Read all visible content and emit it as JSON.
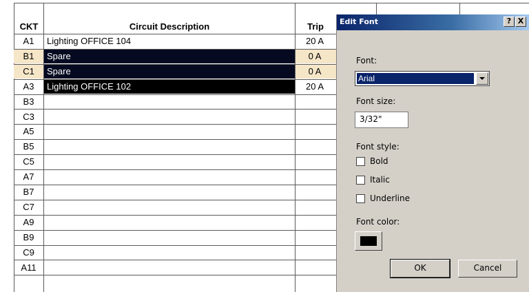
{
  "schedule": {
    "headers": {
      "ckt": "CKT",
      "description": "Circuit Description",
      "trip": "Trip"
    },
    "rows": [
      {
        "ckt": "A1",
        "description": "Lighting OFFICE 104",
        "trip": "20 A",
        "state": "normal"
      },
      {
        "ckt": "B1",
        "description": "Spare",
        "trip": "0 A",
        "state": "selected-light"
      },
      {
        "ckt": "C1",
        "description": "Spare",
        "trip": "0 A",
        "state": "selected-light"
      },
      {
        "ckt": "A3",
        "description": "Lighting OFFICE 102",
        "trip": "20 A",
        "state": "selected-dark"
      },
      {
        "ckt": "B3",
        "description": "",
        "trip": "",
        "state": "normal"
      },
      {
        "ckt": "C3",
        "description": "",
        "trip": "",
        "state": "normal"
      },
      {
        "ckt": "A5",
        "description": "",
        "trip": "",
        "state": "normal"
      },
      {
        "ckt": "B5",
        "description": "",
        "trip": "",
        "state": "normal"
      },
      {
        "ckt": "C5",
        "description": "",
        "trip": "",
        "state": "normal"
      },
      {
        "ckt": "A7",
        "description": "",
        "trip": "",
        "state": "normal"
      },
      {
        "ckt": "B7",
        "description": "",
        "trip": "",
        "state": "normal"
      },
      {
        "ckt": "C7",
        "description": "",
        "trip": "",
        "state": "normal"
      },
      {
        "ckt": "A9",
        "description": "",
        "trip": "",
        "state": "normal"
      },
      {
        "ckt": "B9",
        "description": "",
        "trip": "",
        "state": "normal"
      },
      {
        "ckt": "C9",
        "description": "",
        "trip": "",
        "state": "normal"
      },
      {
        "ckt": "A11",
        "description": "",
        "trip": "",
        "state": "normal"
      }
    ]
  },
  "dialog": {
    "title": "Edit Font",
    "help_label": "?",
    "close_label": "X",
    "font_label": "Font:",
    "font_value": "Arial",
    "size_label": "Font size:",
    "size_value": "3/32\"",
    "style_label": "Font style:",
    "bold_label": "Bold",
    "bold_checked": false,
    "italic_label": "Italic",
    "italic_checked": false,
    "underline_label": "Underline",
    "underline_checked": false,
    "color_label": "Font color:",
    "color_value": "#000000",
    "ok_label": "OK",
    "cancel_label": "Cancel"
  },
  "colors": {
    "highlight_light": "#f5e6c8",
    "highlight_dark": "#000000",
    "selected_text_bg": "#050a20",
    "titlebar": "#0a246a",
    "dialog_face": "#d4d0c8"
  },
  "icons": {
    "dropdown": "chevron-down-icon",
    "help": "help-icon",
    "close": "close-icon"
  }
}
